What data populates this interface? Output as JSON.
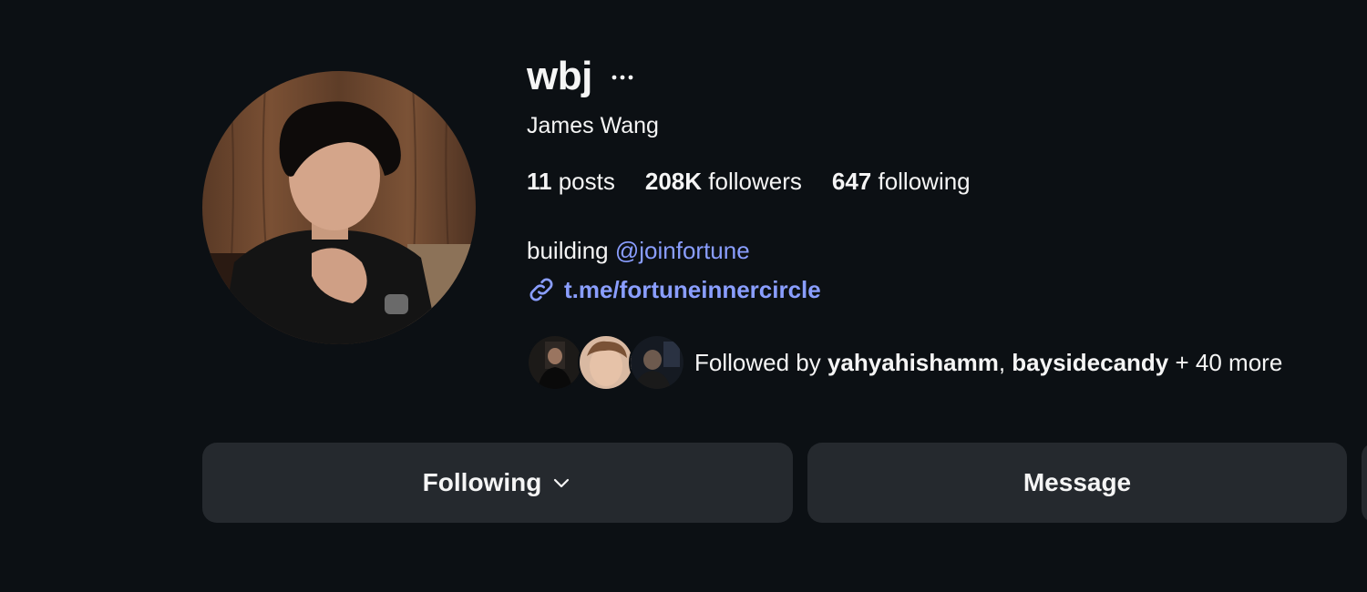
{
  "profile": {
    "username": "wbj",
    "more_icon": "ellipsis-icon",
    "full_name": "James Wang",
    "stats": {
      "posts_count": "11",
      "posts_label": " posts",
      "followers_count": "208K",
      "followers_label": " followers",
      "following_count": "647",
      "following_label": " following"
    },
    "bio": {
      "prefix": "building ",
      "mention": "@joinfortune"
    },
    "link": {
      "icon": "link-icon",
      "text": "t.me/fortuneinnercircle"
    },
    "followed_by": {
      "prefix": "Followed by ",
      "user1": "yahyahishamm",
      "separator": ", ",
      "user2": "baysidecandy",
      "suffix": " + 40 more"
    }
  },
  "actions": {
    "following_label": "Following",
    "following_icon": "chevron-down-icon",
    "message_label": "Message"
  },
  "colors": {
    "background": "#0c1014",
    "text": "#f5f5f5",
    "link": "#8a9eff",
    "button": "#25292e"
  }
}
